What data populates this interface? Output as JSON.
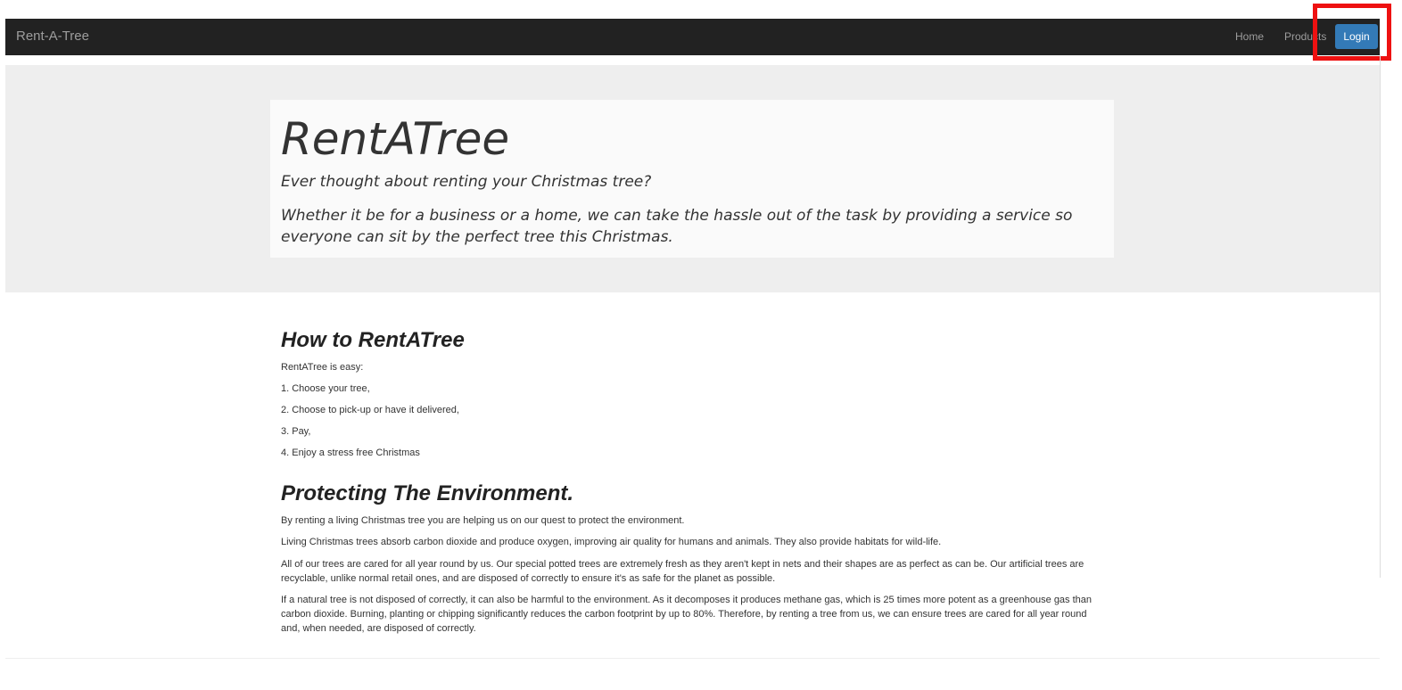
{
  "navbar": {
    "brand": "Rent-A-Tree",
    "links": [
      {
        "label": "Home"
      },
      {
        "label": "Products"
      }
    ],
    "login_label": "Login",
    "background": "#222222",
    "login_color": "#337ab7",
    "highlight_color": "#ee1111"
  },
  "hero": {
    "title": "RentATree",
    "subtitle": "Ever thought about renting your Christmas tree?",
    "body": "Whether it be for a business or a home, we can take the hassle out of the task by providing a service so everyone can sit by the perfect tree this Christmas."
  },
  "how_to": {
    "title": "How to RentATree",
    "intro": "RentATree is easy:",
    "steps": [
      "1. Choose your tree,",
      "2. Choose to pick-up or have it delivered,",
      "3. Pay,",
      "4. Enjoy a stress free Christmas"
    ]
  },
  "environment": {
    "title": "Protecting The Environment.",
    "paragraphs": [
      "By renting a living Christmas tree you are helping us on our quest to protect the environment.",
      "Living Christmas trees absorb carbon dioxide and produce oxygen, improving air quality for humans and animals. They also provide habitats for wild-life.",
      "All of our trees are cared for all year round by us. Our special potted trees are extremely fresh as they aren't kept in nets and their shapes are as perfect as can be. Our artificial trees are recyclable, unlike normal retail ones, and are disposed of correctly to ensure it's as safe for the planet as possible.",
      "If a natural tree is not disposed of correctly, it can also be harmful to the environment. As it decomposes it produces methane gas, which is 25 times more potent as a greenhouse gas than carbon dioxide. Burning, planting or chipping significantly reduces the carbon footprint by up to 80%. Therefore, by renting a tree from us, we can ensure trees are cared for all year round and, when needed, are disposed of correctly."
    ]
  }
}
